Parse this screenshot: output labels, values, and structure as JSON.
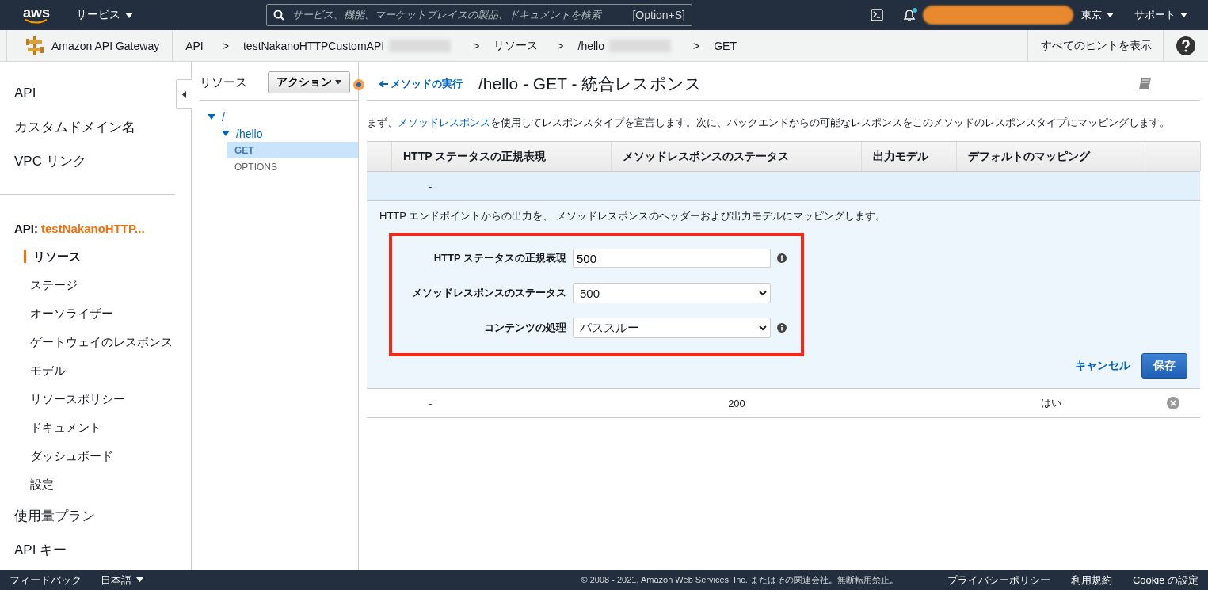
{
  "topbar": {
    "logo": "aws",
    "services": "サービス",
    "search_placeholder": "サービス、機能、マーケットプレイスの製品、ドキュメントを検索",
    "search_shortcut": "[Option+S]",
    "notification_unread": true,
    "region": "東京",
    "support": "サポート"
  },
  "breadcrumb": {
    "product": "Amazon API Gateway",
    "crumbs": [
      {
        "kind": "link",
        "label": "API"
      },
      {
        "kind": "separator",
        "label": ">"
      },
      {
        "kind": "link",
        "label": "testNakanoHTTPCustomAPI",
        "redacted": true
      },
      {
        "kind": "separator",
        "label": ">"
      },
      {
        "kind": "link",
        "label": "リソース"
      },
      {
        "kind": "separator",
        "label": ">"
      },
      {
        "kind": "link",
        "label": "/hello",
        "redacted": true
      },
      {
        "kind": "separator",
        "label": ">"
      },
      {
        "kind": "link",
        "label": "GET"
      }
    ],
    "hints": "すべてのヒントを表示"
  },
  "sidebar": {
    "top_items": [
      "API",
      "カスタムドメイン名",
      "VPC リンク"
    ],
    "api_label": "API:",
    "api_name": "testNakanoHTTP...",
    "api_items": [
      {
        "label": "リソース",
        "selected": true
      },
      {
        "label": "ステージ",
        "selected": false
      },
      {
        "label": "オーソライザー",
        "selected": false
      },
      {
        "label": "ゲートウェイのレスポンス",
        "selected": false
      },
      {
        "label": "モデル",
        "selected": false
      },
      {
        "label": "リソースポリシー",
        "selected": false
      },
      {
        "label": "ドキュメント",
        "selected": false
      },
      {
        "label": "ダッシュボード",
        "selected": false
      },
      {
        "label": "設定",
        "selected": false
      }
    ],
    "bottom_items": [
      "使用量プラン",
      "API キー"
    ]
  },
  "resources": {
    "title": "リソース",
    "action": "アクション",
    "tree": [
      {
        "label": "/",
        "kind": "resource",
        "expanded": true,
        "selected": false,
        "children": [
          {
            "label": "/hello",
            "kind": "resource",
            "expanded": true,
            "selected": false,
            "children": [
              {
                "label": "GET",
                "kind": "method",
                "selected": true
              },
              {
                "label": "OPTIONS",
                "kind": "method",
                "selected": false
              }
            ]
          }
        ]
      }
    ]
  },
  "main": {
    "back_link": "メソッドの実行",
    "title": "/hello - GET - 統合レスポンス",
    "description": {
      "before": "まず、",
      "link": "メソッドレスポンス",
      "after": "を使用してレスポンスタイプを宣言します。次に、バックエンドからの可能なレスポンスをこのメソッドのレスポンスタイプにマッピングします。"
    },
    "table": {
      "columns": [
        "HTTP ステータスの正規表現",
        "メソッドレスポンスのステータス",
        "出力モデル",
        "デフォルトのマッピング"
      ],
      "rows": [
        {
          "cells": [
            "-",
            "",
            "",
            ""
          ],
          "expanded": true,
          "deletable": false
        },
        {
          "cells": [
            "-",
            "200",
            "",
            "はい"
          ],
          "expanded": false,
          "deletable": true
        }
      ]
    },
    "form": {
      "note": "HTTP エンドポイントからの出力を、 メソッドレスポンスのヘッダーおよび出力モデルにマッピングします。",
      "fields": [
        {
          "kind": "text",
          "label": "HTTP ステータスの正規表現",
          "value": "500",
          "info": true
        },
        {
          "kind": "select",
          "label": "メソッドレスポンスのステータス",
          "value": "500"
        },
        {
          "kind": "select",
          "label": "コンテンツの処理",
          "value": "パススルー",
          "info": true
        }
      ],
      "cancel": "キャンセル",
      "save": "保存"
    }
  },
  "footer": {
    "feedback": "フィードバック",
    "language": "日本語",
    "copyright": "© 2008 - 2021, Amazon Web Services, Inc. またはその関連会社。無断転用禁止。",
    "links": [
      "プライバシーポリシー",
      "利用規約",
      "Cookie の設定"
    ]
  }
}
